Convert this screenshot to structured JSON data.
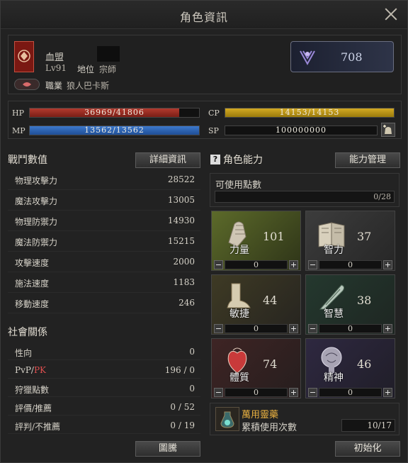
{
  "window": {
    "title": "角色資訊"
  },
  "profile": {
    "name": "血盟",
    "level": "Lv91",
    "rank_label": "地位",
    "rank_value": "宗師",
    "class_label": "職業",
    "class_value": "狼人巴卡斯",
    "score": "708"
  },
  "vitals": {
    "hp_label": "HP",
    "hp_value": "36969/41806",
    "hp_fraction": 0.884,
    "mp_label": "MP",
    "mp_value": "13562/13562",
    "mp_fraction": 1.0,
    "cp_label": "CP",
    "cp_value": "14153/14153",
    "cp_fraction": 1.0,
    "sp_label": "SP",
    "sp_value": "100000000"
  },
  "combat": {
    "title": "戰鬥數值",
    "detail_button": "詳細資訊",
    "rows": [
      {
        "label": "物理攻擊力",
        "value": "28522"
      },
      {
        "label": "魔法攻擊力",
        "value": "13005"
      },
      {
        "label": "物理防禦力",
        "value": "14930"
      },
      {
        "label": "魔法防禦力",
        "value": "15215"
      },
      {
        "label": "攻擊速度",
        "value": "2000"
      },
      {
        "label": "施法速度",
        "value": "1183"
      },
      {
        "label": "移動速度",
        "value": "246"
      }
    ]
  },
  "social": {
    "title": "社會關係",
    "rows": [
      {
        "label": "性向",
        "value": "0"
      },
      {
        "label_a": "PvP/",
        "label_b": "PK",
        "value": "196 / 0"
      },
      {
        "label": "狩獵點數",
        "value": "0"
      },
      {
        "label": "評價/推薦",
        "value": "0 / 52"
      },
      {
        "label": "評判/不推薦",
        "value": "0 / 19"
      }
    ],
    "crest_button": "圖騰"
  },
  "abilities": {
    "help_mark": "?",
    "title": "角色能力",
    "manage_button": "能力管理",
    "points_label": "可使用點數",
    "points_value": "0/28",
    "cells": [
      {
        "name": "力量",
        "value": "101",
        "alloc": "0",
        "icon": "fist-icon"
      },
      {
        "name": "智力",
        "value": "37",
        "alloc": "0",
        "icon": "book-icon"
      },
      {
        "name": "敏捷",
        "value": "44",
        "alloc": "0",
        "icon": "foot-icon"
      },
      {
        "name": "智慧",
        "value": "38",
        "alloc": "0",
        "icon": "quill-icon"
      },
      {
        "name": "體質",
        "value": "74",
        "alloc": "0",
        "icon": "heart-icon"
      },
      {
        "name": "精神",
        "value": "46",
        "alloc": "0",
        "icon": "mind-icon"
      }
    ],
    "potion_name": "萬用靈藥",
    "potion_label": "累積使用次數",
    "potion_value": "10/17",
    "reset_button": "初始化"
  },
  "colors": {
    "hp": "#9a2b22",
    "mp": "#2d62b5",
    "cp": "#b59014",
    "accent": "#e8b040"
  }
}
